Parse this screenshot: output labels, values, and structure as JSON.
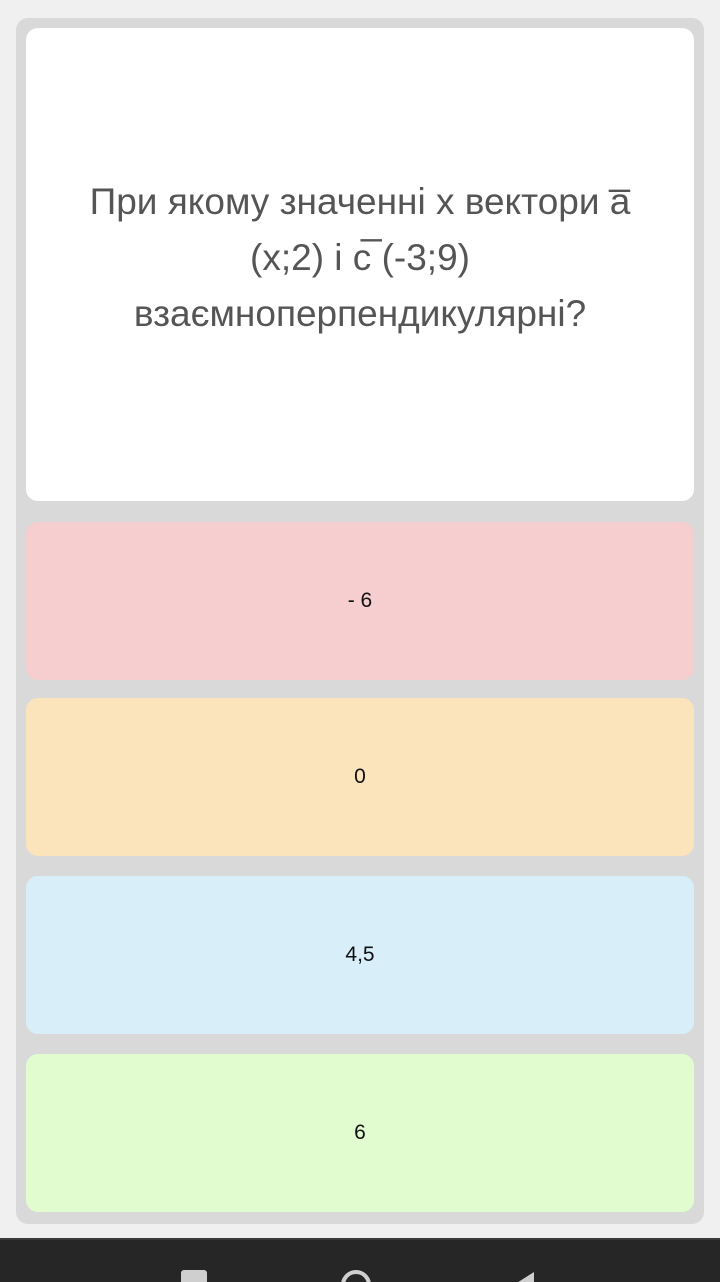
{
  "question": {
    "text": "При якому значенні х вектори a̅ (х;2) і с̅ (-3;9) взаємноперпендикулярні?"
  },
  "answers": [
    {
      "label": "- 6",
      "color": "#f6cecf"
    },
    {
      "label": "0",
      "color": "#fbe3bb"
    },
    {
      "label": "4,5",
      "color": "#d8eff9"
    },
    {
      "label": "6",
      "color": "#e1fdd0"
    }
  ],
  "nav": {
    "icons": [
      "recent-apps-icon",
      "home-icon",
      "back-icon"
    ]
  }
}
